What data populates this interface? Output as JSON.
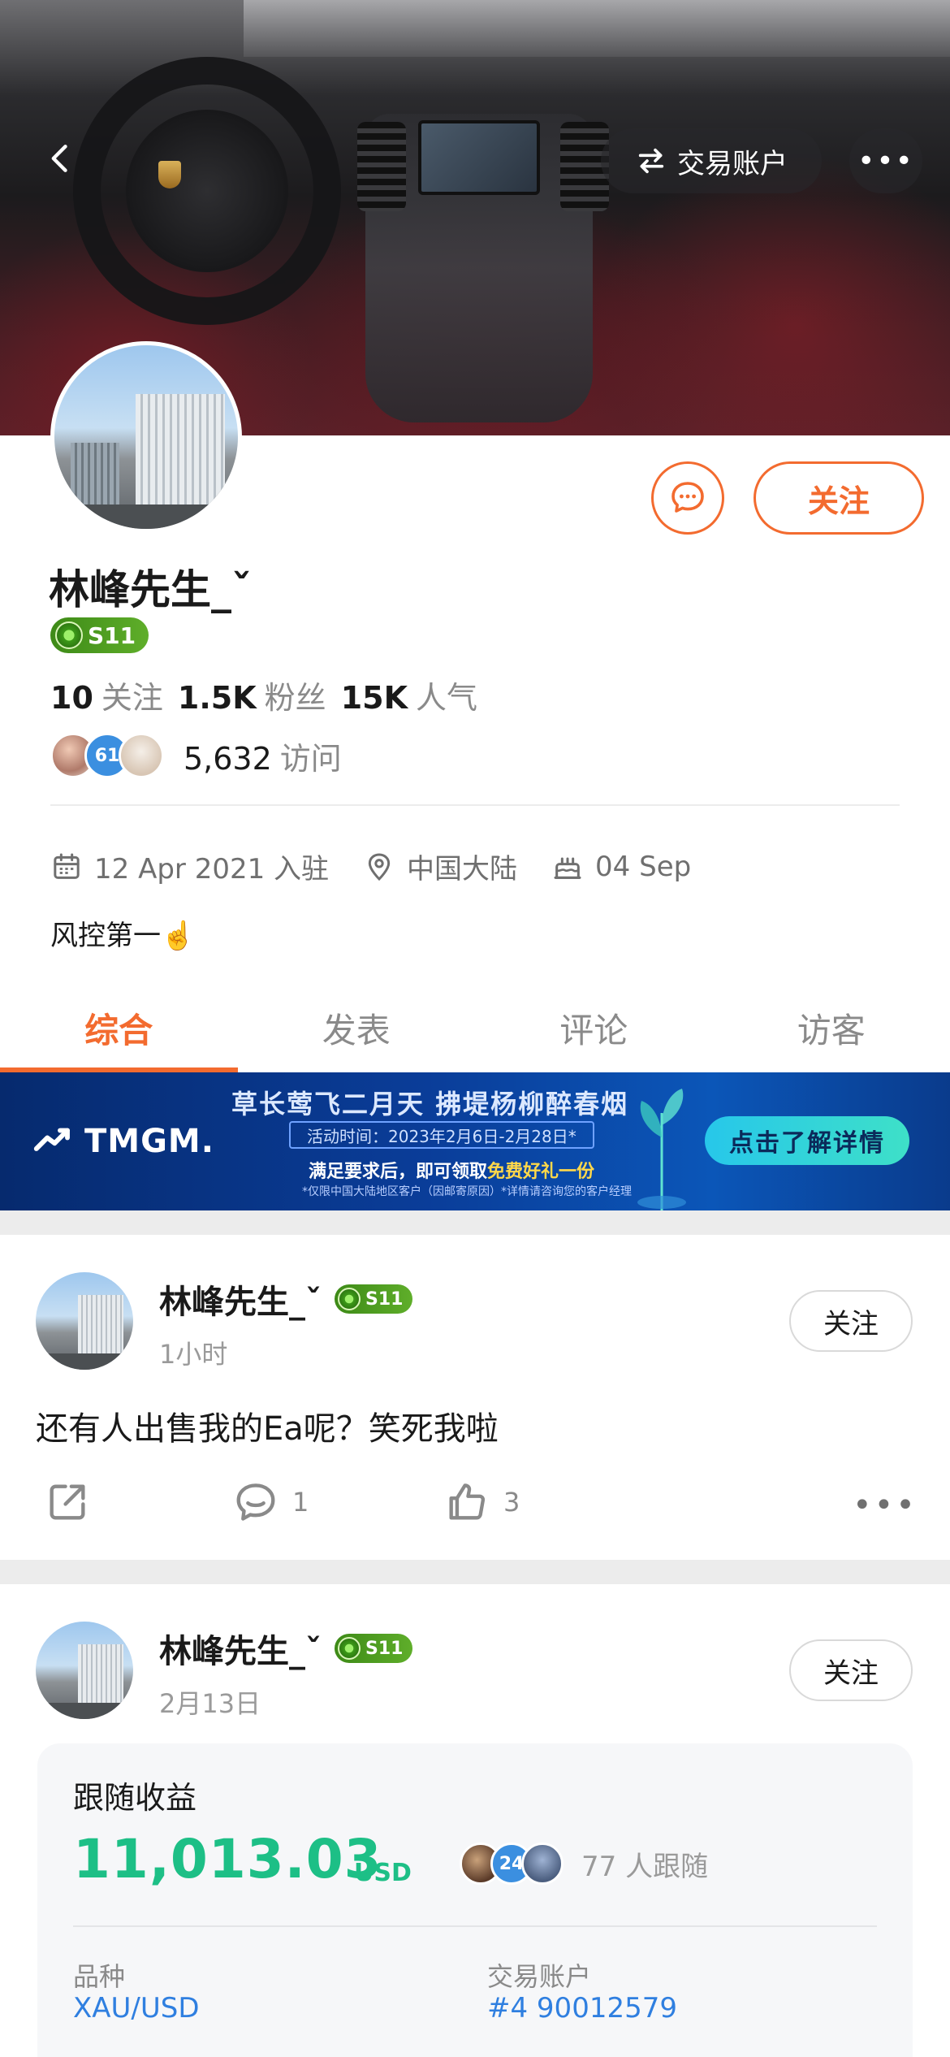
{
  "header": {
    "trade_account_label": "交易账户",
    "more_label": "•••"
  },
  "profile": {
    "name": "林峰先生_ˇ",
    "level": "S11",
    "following_count": "10",
    "following_label": "关注",
    "fans_count": "1.5K",
    "fans_label": "粉丝",
    "popularity_count": "15K",
    "popularity_label": "人气",
    "visitor_badge_count": "61",
    "visits_count": "5,632",
    "visits_label": "访问",
    "joined": "12 Apr 2021 入驻",
    "location": "中国大陆",
    "birthday": "04 Sep",
    "bio": "风控第一☝️",
    "follow_button": "关注"
  },
  "tabs": [
    {
      "label": "综合",
      "active": true
    },
    {
      "label": "发表",
      "active": false
    },
    {
      "label": "评论",
      "active": false
    },
    {
      "label": "访客",
      "active": false
    }
  ],
  "banner": {
    "brand": "TMGM.",
    "headline": "草长莺飞二月天  拂堤杨柳醉春烟",
    "activity_time": "活动时间：2023年2月6日-2月28日*",
    "offer_prefix": "满足要求后，即可领取",
    "offer_highlight": "免费好礼一份",
    "fineprint": "*仅限中国大陆地区客户（因邮寄原因）*详情请咨询您的客户经理",
    "cta": "点击了解详情"
  },
  "posts": [
    {
      "author": "林峰先生_ˇ",
      "level": "S11",
      "time": "1小时",
      "follow": "关注",
      "text": "还有人出售我的Ea呢？笑死我啦",
      "comments": "1",
      "likes": "3",
      "more": "•••"
    },
    {
      "author": "林峰先生_ˇ",
      "level": "S11",
      "time": "2月13日",
      "follow": "关注",
      "card": {
        "title": "跟随收益",
        "amount": "11,013.03",
        "currency": "USD",
        "follower_badge_count": "24",
        "followers_text": "77 人跟随",
        "symbol_label": "品种",
        "symbol_value": "XAU/USD",
        "account_label": "交易账户",
        "account_value": "#4 90012579"
      }
    }
  ],
  "colors": {
    "accent": "#f36b2f",
    "profit_green": "#1dbf86",
    "link_blue": "#2f7fe0",
    "level_green": "#4a9c20"
  }
}
